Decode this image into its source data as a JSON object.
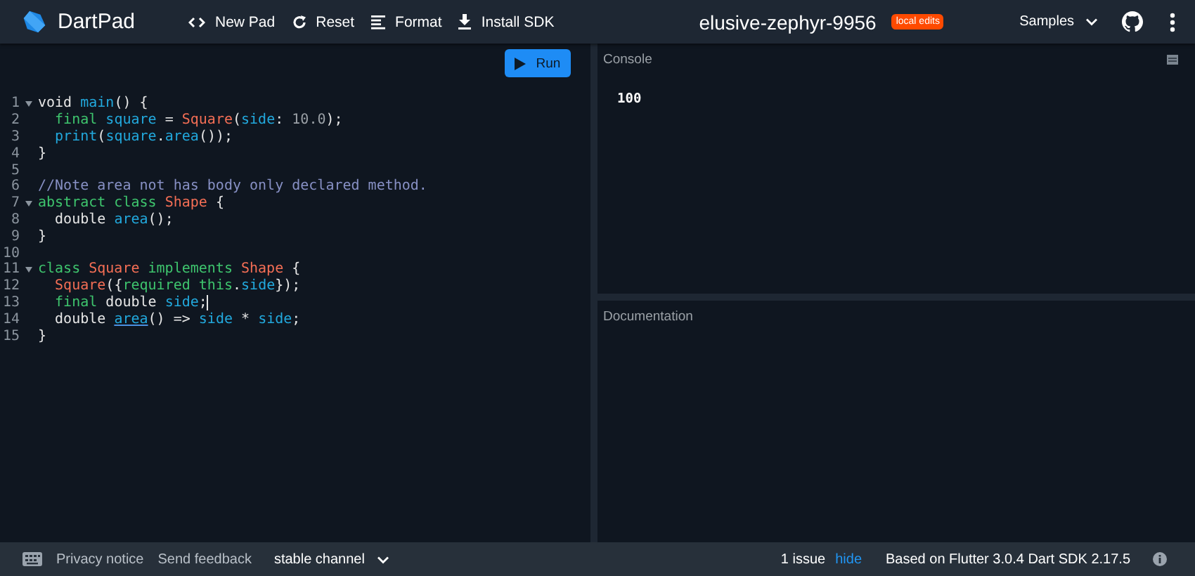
{
  "header": {
    "app_name": "DartPad",
    "actions": [
      {
        "kind": "code",
        "label": "New Pad"
      },
      {
        "kind": "reset",
        "label": "Reset"
      },
      {
        "kind": "format",
        "label": "Format"
      },
      {
        "kind": "download",
        "label": "Install SDK"
      }
    ],
    "pad_title": "elusive-zephyr-9956",
    "badge": "local edits",
    "samples": "Samples"
  },
  "editor": {
    "run_button": "Run",
    "lines": [
      {
        "number": "1",
        "fold": true,
        "cursor": false,
        "tokens": [
          {
            "kind": "plain",
            "text": "void "
          },
          {
            "kind": "ident",
            "text": "main"
          },
          {
            "kind": "plain",
            "text": "() {"
          }
        ]
      },
      {
        "number": "2",
        "fold": false,
        "cursor": false,
        "tokens": [
          {
            "kind": "keyword",
            "text": "  final "
          },
          {
            "kind": "ident",
            "text": "square"
          },
          {
            "kind": "plain",
            "text": " = "
          },
          {
            "kind": "type",
            "text": "Square"
          },
          {
            "kind": "plain",
            "text": "("
          },
          {
            "kind": "ident",
            "text": "side"
          },
          {
            "kind": "plain",
            "text": ": "
          },
          {
            "kind": "number",
            "text": "10.0"
          },
          {
            "kind": "plain",
            "text": ");"
          }
        ]
      },
      {
        "number": "3",
        "fold": false,
        "cursor": false,
        "tokens": [
          {
            "kind": "ident",
            "text": "  print"
          },
          {
            "kind": "plain",
            "text": "("
          },
          {
            "kind": "ident",
            "text": "square"
          },
          {
            "kind": "plain",
            "text": "."
          },
          {
            "kind": "ident",
            "text": "area"
          },
          {
            "kind": "plain",
            "text": "());"
          }
        ]
      },
      {
        "number": "4",
        "fold": false,
        "cursor": false,
        "tokens": [
          {
            "kind": "plain",
            "text": "}"
          }
        ]
      },
      {
        "number": "5",
        "fold": false,
        "cursor": false
      },
      {
        "number": "6",
        "fold": false,
        "cursor": false,
        "tokens": [
          {
            "kind": "comment",
            "text": "//Note area not has body only declared method."
          }
        ]
      },
      {
        "number": "7",
        "fold": true,
        "cursor": false,
        "tokens": [
          {
            "kind": "keyword",
            "text": "abstract class "
          },
          {
            "kind": "type",
            "text": "Shape"
          },
          {
            "kind": "plain",
            "text": " {"
          }
        ]
      },
      {
        "number": "8",
        "fold": false,
        "cursor": false,
        "tokens": [
          {
            "kind": "plain",
            "text": "  double "
          },
          {
            "kind": "ident",
            "text": "area"
          },
          {
            "kind": "plain",
            "text": "();"
          }
        ]
      },
      {
        "number": "9",
        "fold": false,
        "cursor": false,
        "tokens": [
          {
            "kind": "plain",
            "text": "}"
          }
        ]
      },
      {
        "number": "10",
        "fold": false,
        "cursor": false
      },
      {
        "number": "11",
        "fold": true,
        "cursor": false,
        "tokens": [
          {
            "kind": "keyword",
            "text": "class "
          },
          {
            "kind": "type",
            "text": "Square"
          },
          {
            "kind": "keyword",
            "text": " implements "
          },
          {
            "kind": "type",
            "text": "Shape"
          },
          {
            "kind": "plain",
            "text": " {"
          }
        ]
      },
      {
        "number": "12",
        "fold": false,
        "cursor": false,
        "tokens": [
          {
            "kind": "type",
            "text": "  Square"
          },
          {
            "kind": "plain",
            "text": "({"
          },
          {
            "kind": "keyword",
            "text": "required this"
          },
          {
            "kind": "plain",
            "text": "."
          },
          {
            "kind": "ident",
            "text": "side"
          },
          {
            "kind": "plain",
            "text": "});"
          }
        ]
      },
      {
        "number": "13",
        "fold": false,
        "cursor": true,
        "tokens": [
          {
            "kind": "keyword",
            "text": "  final "
          },
          {
            "kind": "plain",
            "text": "double "
          },
          {
            "kind": "ident",
            "text": "side"
          },
          {
            "kind": "plain",
            "text": ";"
          }
        ]
      },
      {
        "number": "14",
        "fold": false,
        "cursor": false,
        "tokens": [
          {
            "kind": "plain",
            "text": "  double "
          },
          {
            "kind": "issue",
            "text": "area"
          },
          {
            "kind": "plain",
            "text": "() => "
          },
          {
            "kind": "ident",
            "text": "side"
          },
          {
            "kind": "plain",
            "text": " * "
          },
          {
            "kind": "ident",
            "text": "side"
          },
          {
            "kind": "plain",
            "text": ";"
          }
        ]
      },
      {
        "number": "15",
        "fold": false,
        "cursor": false,
        "tokens": [
          {
            "kind": "plain",
            "text": "}"
          }
        ]
      }
    ]
  },
  "console": {
    "title": "Console",
    "output": "100"
  },
  "documentation": {
    "title": "Documentation"
  },
  "footer": {
    "privacy": "Privacy notice",
    "feedback": "Send feedback",
    "channel": "stable channel",
    "issues": "1 issue",
    "hide": "hide",
    "version": "Based on Flutter 3.0.4 Dart SDK 2.17.5"
  }
}
